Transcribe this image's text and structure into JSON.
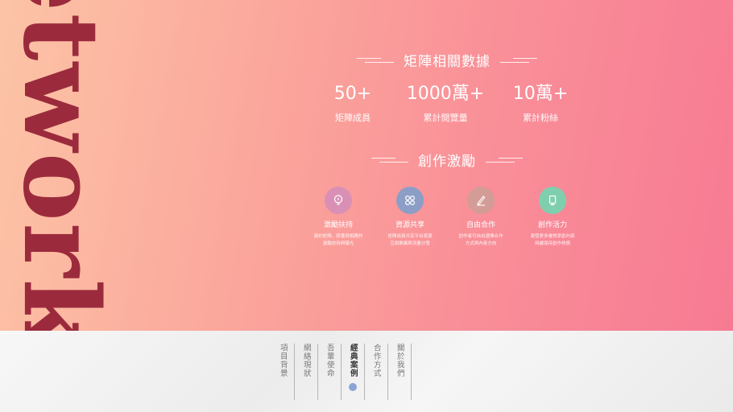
{
  "hero": {
    "big_word": "etwork",
    "stats_heading": "矩陣相關數據",
    "stats": [
      {
        "value": "50+",
        "label": "矩陣成員"
      },
      {
        "value": "1000萬+",
        "label": "累計閱覽量"
      },
      {
        "value": "10萬+",
        "label": "累計粉絲"
      }
    ],
    "features_heading": "創作激勵",
    "features": [
      {
        "title": "激勵扶持",
        "desc1": "簽約矩陣，將獲得相應的",
        "desc2": "激勵扶持與曝光",
        "icon": "lightbulb-icon",
        "color": "#d990b4"
      },
      {
        "title": "資源共享",
        "desc1": "矩陣成員共享平台資源",
        "desc2": "互相推廣與流量分發",
        "icon": "grid-icon",
        "color": "#8c9ec6"
      },
      {
        "title": "自由合作",
        "desc1": "創作者可自由選擇合作",
        "desc2": "方式與內容方向",
        "icon": "pen-icon",
        "color": "#d49c97"
      },
      {
        "title": "創作活力",
        "desc1": "激發更多優質原創內容",
        "desc2": "持續保持創作熱情",
        "icon": "phone-icon",
        "color": "#7fcfae"
      }
    ]
  },
  "nav": {
    "items": [
      {
        "label": "項目背景",
        "active": false
      },
      {
        "label": "網絡現狀",
        "active": false
      },
      {
        "label": "吾輩使命",
        "active": false
      },
      {
        "label": "經典案例",
        "active": true
      },
      {
        "label": "合作方式",
        "active": false
      },
      {
        "label": "關於我們",
        "active": false
      }
    ]
  }
}
